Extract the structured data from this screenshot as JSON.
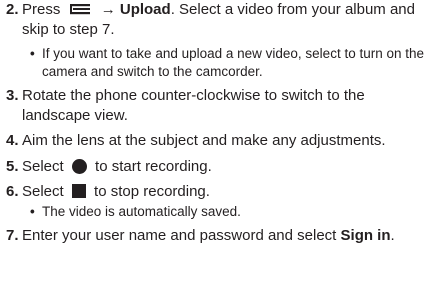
{
  "steps": [
    {
      "num": "2.",
      "pre": "Press",
      "arrow": "→",
      "bold": "Upload",
      "rest": ". Select a video from your album and skip to step 7."
    },
    {
      "bullet": "If you want to take and upload a new video, select to turn on the camera and switch to the camcorder."
    },
    {
      "num": "3.",
      "text": "Rotate the phone counter-clockwise to switch to the landscape view."
    },
    {
      "num": "4.",
      "text": "Aim the lens at the subject and make any adjustments."
    },
    {
      "num": "5.",
      "pre": "Select",
      "post": "to start recording."
    },
    {
      "num": "6.",
      "pre": "Select",
      "post": "to stop recording."
    },
    {
      "bullet": "The video is automatically saved."
    },
    {
      "num": "7.",
      "pre": "Enter your user name and password and select",
      "bold": "Sign in",
      "post": "."
    }
  ],
  "bullet_char": "•",
  "icons": {
    "menu": "menu-key-icon",
    "record": "record-button-icon",
    "stop": "stop-button-icon"
  }
}
